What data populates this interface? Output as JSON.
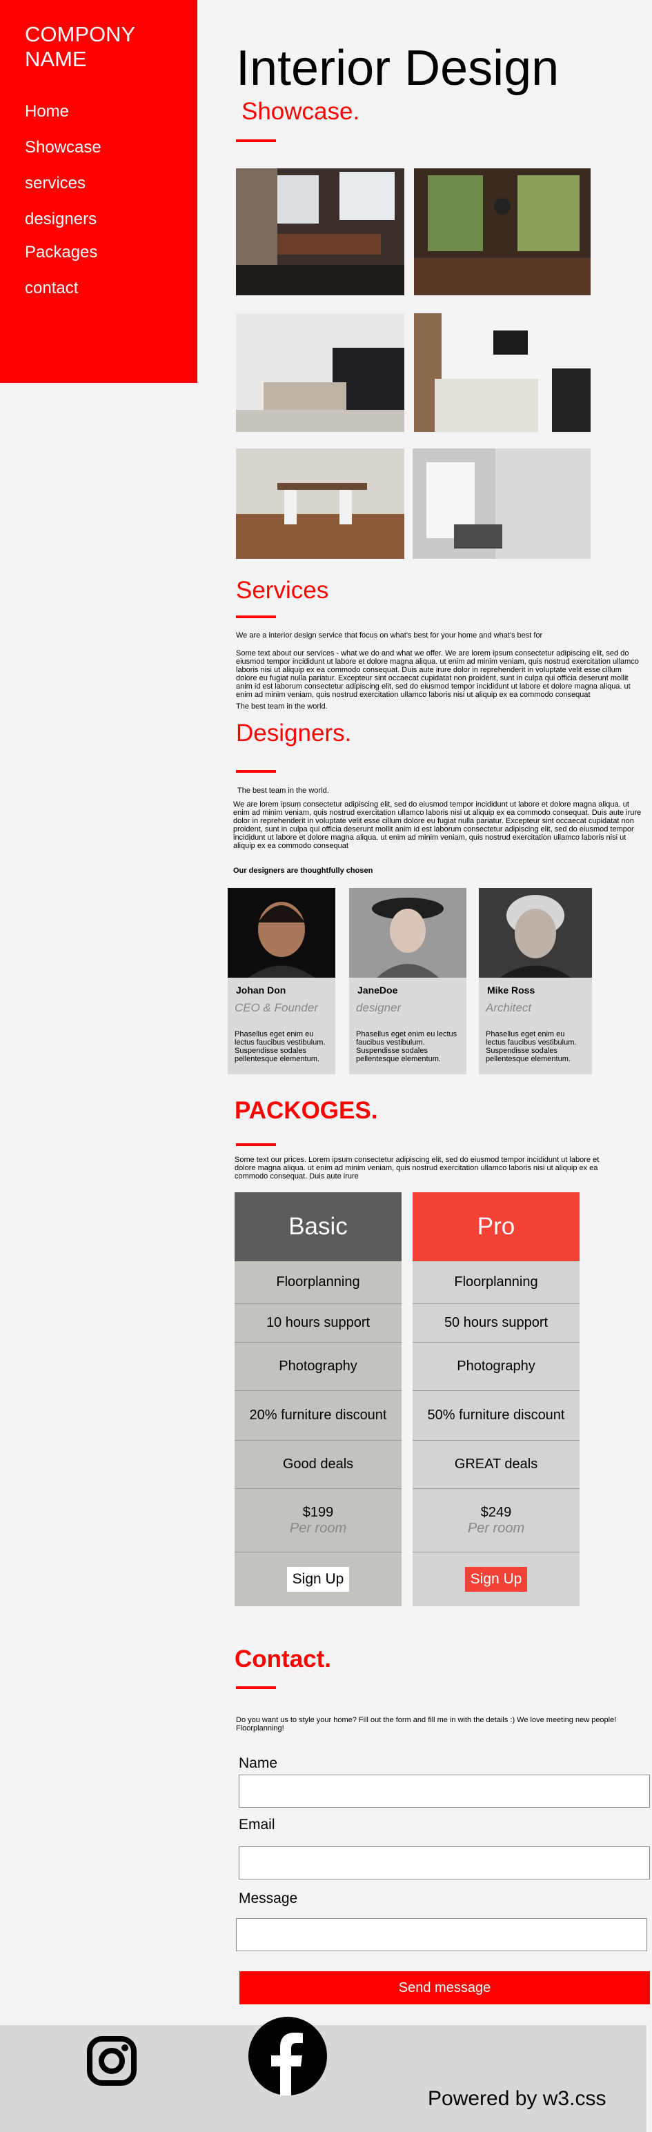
{
  "sidebar": {
    "brand_line1": "COMPONY",
    "brand_line2": "NAME",
    "nav": [
      "Home",
      "Showcase",
      "services",
      "designers",
      "Packages",
      "contact"
    ]
  },
  "hero": {
    "title": "Interior Design",
    "subtitle": "Showcase."
  },
  "services": {
    "title": "Services",
    "intro": "We are a interior design service that focus on what's best for your home and what's best for",
    "body": "Some text about our services - what we do and what we offer. We are lorem ipsum consectetur adipiscing elit, sed do eiusmod tempor incididunt ut labore et dolore magna aliqua. ut enim ad minim veniam, quis nostrud exercitation ullamco laboris nisi ut aliquip ex ea commodo consequat. Duis aute irure dolor in reprehenderit in voluptate velit esse cillum dolore eu fugiat nulla pariatur. Excepteur sint occaecat cupidatat non proident, sunt in culpa qui officia deserunt mollit anim id est laborum consectetur adipiscing elit, sed do eiusmod tempor incididunt ut labore et dolore magna aliqua. ut enim ad minim veniam, quis nostrud exercitation ullamco laboris nisi ut aliquip ex ea commodo consequat",
    "closing": "The best team in the world."
  },
  "designers": {
    "title": "Designers.",
    "intro": "The best team in the world.",
    "body": "We are lorem ipsum consectetur adipiscing elit, sed do eiusmod tempor incididunt ut labore et dolore magna aliqua. ut enim ad minim veniam, quis nostrud exercitation ullamco laboris nisi ut aliquip ex ea commodo consequat. Duis aute irure dolor in reprehenderit in voluptate velit esse cillum dolore eu fugiat nulla pariatur. Excepteur sint occaecat cupidatat non proident, sunt in culpa qui officia deserunt mollit anim id est laborum consectetur adipiscing elit, sed do eiusmod tempor incididunt ut labore et dolore magna aliqua. ut enim ad minim veniam, quis nostrud exercitation ullamco laboris nisi ut aliquip ex ea commodo consequat",
    "chosen": "Our designers are thoughtfully chosen",
    "people": [
      {
        "name": "Johan Don",
        "role": "CEO & Founder",
        "desc": "Phasellus eget enim eu lectus faucibus vestibulum. Suspendisse sodales pellentesque elementum."
      },
      {
        "name": "JaneDoe",
        "role": "designer",
        "desc": "Phasellus eget enim eu lectus faucibus vestibulum. Suspendisse sodales pellentesque elementum."
      },
      {
        "name": "Mike Ross",
        "role": "Architect",
        "desc": "Phasellus eget enim eu lectus faucibus vestibulum. Suspendisse sodales pellentesque elementum."
      }
    ]
  },
  "packages": {
    "title": "PACKOGES.",
    "intro": "Some text our prices. Lorem ipsum consectetur adipiscing elit, sed do eiusmod tempor incididunt ut labore et dolore magna aliqua. ut enim ad minim veniam, quis nostrud exercitation ullamco laboris nisi ut aliquip ex ea commodo consequat. Duis aute irure",
    "plans": [
      {
        "name": "Basic",
        "features": [
          "Floorplanning",
          "10 hours support",
          "Photography",
          "20% furniture discount",
          "Good deals"
        ],
        "price": "$199",
        "per": "Per room",
        "button": "Sign Up"
      },
      {
        "name": "Pro",
        "features": [
          "Floorplanning",
          "50 hours support",
          "Photography",
          "50% furniture discount",
          "GREAT deals"
        ],
        "price": "$249",
        "per": "Per room",
        "button": "Sign Up"
      }
    ]
  },
  "contact": {
    "title": "Contact.",
    "intro": "Do you want us to style your home? Fill out the form and fill me in with the details :) We love meeting new people! Floorplanning!",
    "name_label": "Name",
    "email_label": "Email",
    "message_label": "Message",
    "send_label": "Send message"
  },
  "footer": {
    "powered": "Powered by w3.css"
  },
  "colors": {
    "accent": "#ff0000",
    "pro": "#f44336",
    "basic_head": "#5b5b5b"
  }
}
